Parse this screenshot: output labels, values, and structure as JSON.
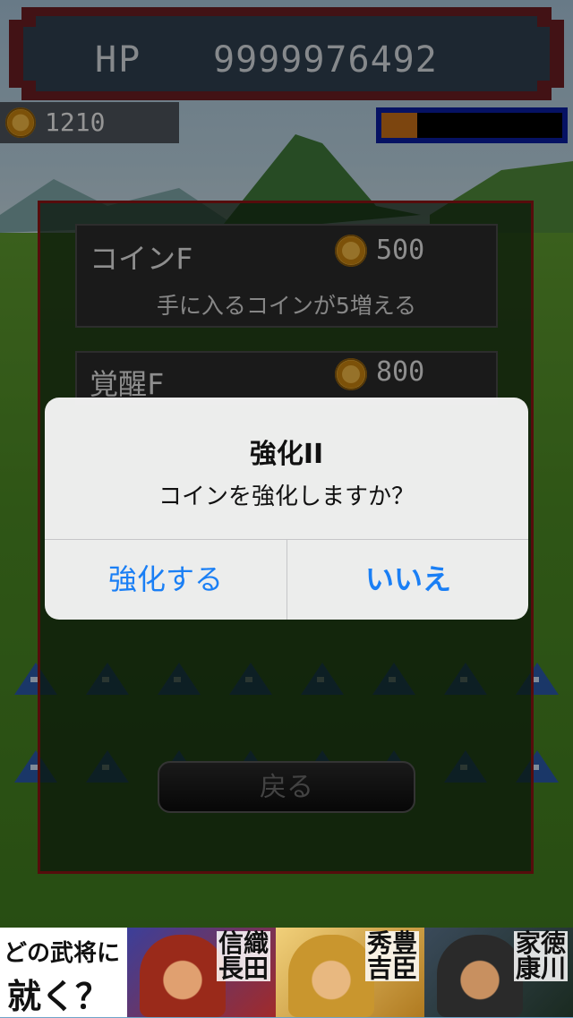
{
  "hud": {
    "hp_label": "HP",
    "hp_value": "9999976492",
    "coins": "1210",
    "gauge_fraction": 0.2
  },
  "shop": {
    "items": [
      {
        "name": "コインF",
        "price": "500",
        "description": "手に入るコインが5増える"
      },
      {
        "name": "覚醒F",
        "price": "800"
      }
    ],
    "back_label": "戻る"
  },
  "alert": {
    "title": "強化II",
    "message": "コインを強化しますか？",
    "confirm_label": "強化する",
    "cancel_label": "いいえ"
  },
  "ad": {
    "line1": "どの武将に",
    "line2": "就く？",
    "warlords": [
      {
        "col1": "信長",
        "col2": "織田"
      },
      {
        "col1": "秀吉",
        "col2": "豊臣"
      },
      {
        "col1": "家康",
        "col2": "徳川"
      }
    ]
  },
  "colors": {
    "accent": "#1a7ff5",
    "panel_border": "#8c1414",
    "gauge_fill": "#c87019",
    "gauge_frame": "#0b1ea0"
  }
}
